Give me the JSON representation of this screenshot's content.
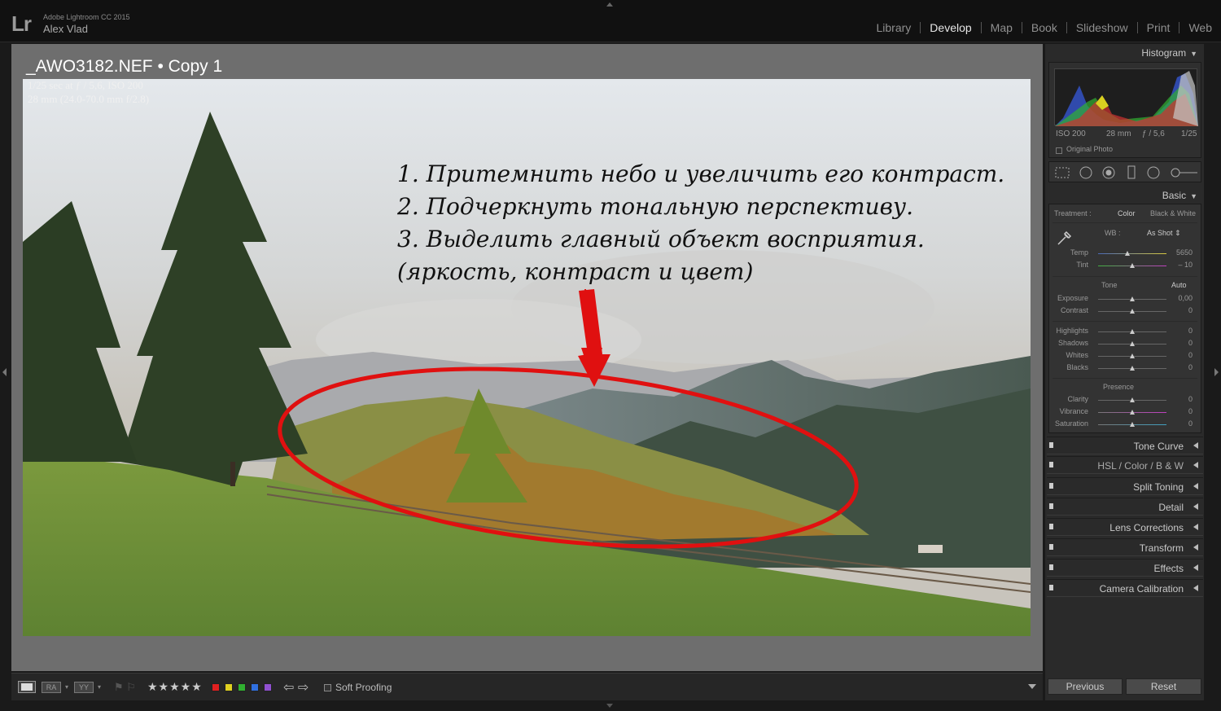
{
  "app": {
    "logo": "Lr",
    "name": "Adobe Lightroom CC 2015",
    "user": "Alex Vlad"
  },
  "modules": [
    "Library",
    "Develop",
    "Map",
    "Book",
    "Slideshow",
    "Print",
    "Web"
  ],
  "active_module": "Develop",
  "image": {
    "title": "_AWO3182.NEF  •  Copy 1",
    "exif_line1": "1/25 sec at ƒ / 5,6, ISO 200",
    "exif_line2": "28 mm (24.0-70.0 mm f/2.8)"
  },
  "annotation": {
    "line1": "1. Притемнить небо и увеличить его контраст.",
    "line2": "2. Подчеркнуть тональную перспективу.",
    "line3": "3. Выделить главный объект восприятия.",
    "line4": "(яркость, контраст и цвет)",
    "color": "#e01010"
  },
  "toolbar": {
    "view_ab": "RA",
    "view_yy": "YY",
    "stars": "★★★★★",
    "color_labels": [
      "#e02020",
      "#e0d020",
      "#30b030",
      "#3070e0",
      "#9050d0"
    ],
    "nav": "⇦ ⇨",
    "soft_proofing": "Soft Proofing"
  },
  "panel": {
    "histogram_title": "Histogram",
    "histogram_info": [
      "ISO 200",
      "28 mm",
      "ƒ / 5,6",
      "1/25"
    ],
    "original_photo": "Original Photo",
    "basic_title": "Basic",
    "treatment_label": "Treatment :",
    "treatment_color": "Color",
    "treatment_bw": "Black & White",
    "wb_label": "WB :",
    "wb_value": "As Shot ⇕",
    "temp_label": "Temp",
    "temp_value": "5650",
    "tint_label": "Tint",
    "tint_value": "– 10",
    "tone_label": "Tone",
    "auto_label": "Auto",
    "exposure_label": "Exposure",
    "exposure_value": "0,00",
    "contrast_label": "Contrast",
    "contrast_value": "0",
    "highlights_label": "Highlights",
    "highlights_value": "0",
    "shadows_label": "Shadows",
    "shadows_value": "0",
    "whites_label": "Whites",
    "whites_value": "0",
    "blacks_label": "Blacks",
    "blacks_value": "0",
    "presence_label": "Presence",
    "clarity_label": "Clarity",
    "clarity_value": "0",
    "vibrance_label": "Vibrance",
    "vibrance_value": "0",
    "saturation_label": "Saturation",
    "saturation_value": "0",
    "sections": {
      "tone_curve": "Tone Curve",
      "hsl": "HSL  /  Color  /  B & W",
      "split_toning": "Split Toning",
      "detail": "Detail",
      "lens_corrections": "Lens Corrections",
      "transform": "Transform",
      "effects": "Effects",
      "camera_calibration": "Camera Calibration"
    },
    "previous": "Previous",
    "reset": "Reset"
  }
}
